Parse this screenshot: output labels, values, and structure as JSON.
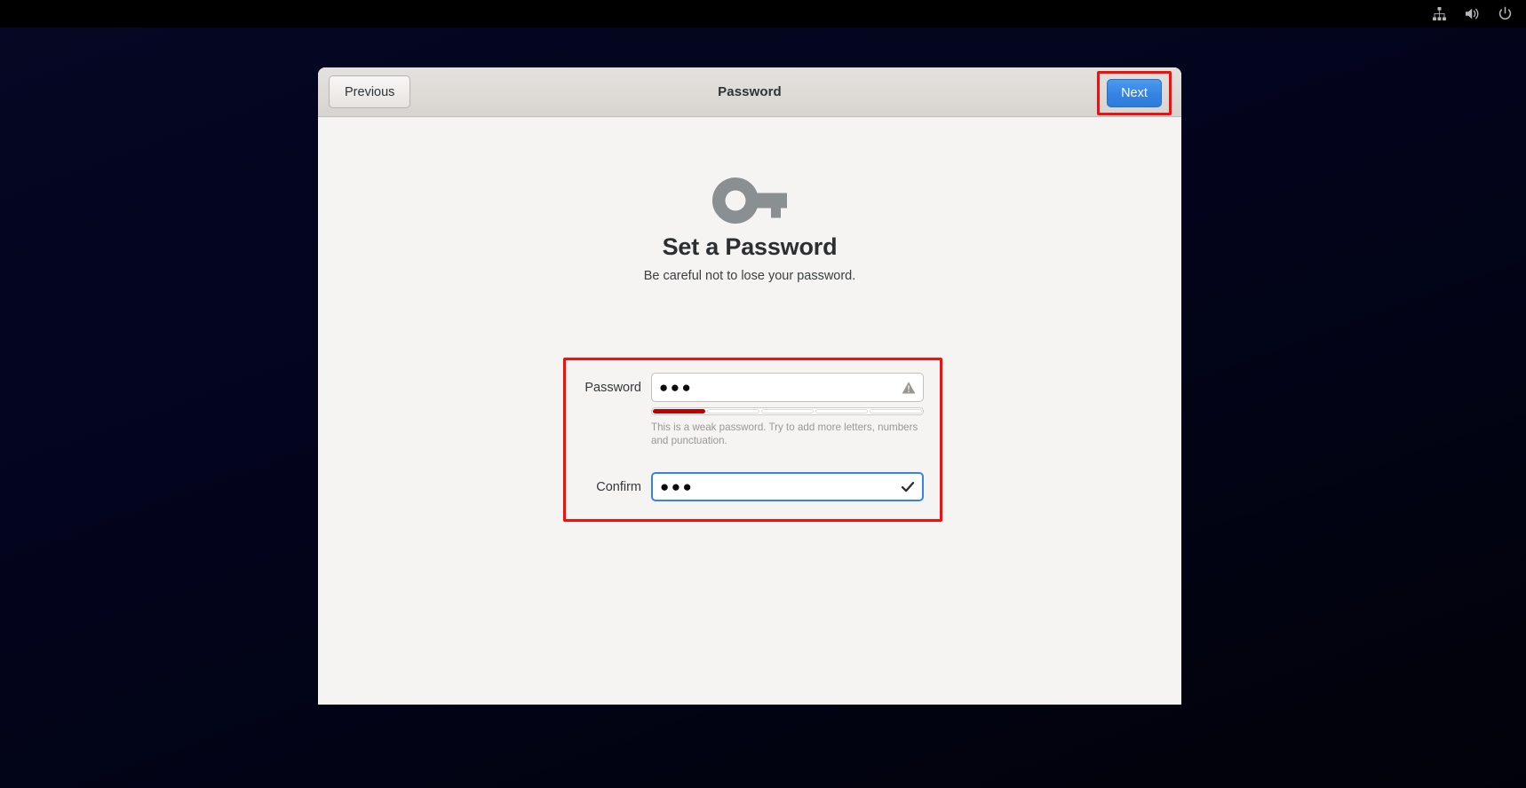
{
  "topbar": {
    "icons": [
      {
        "name": "network-icon",
        "label": "Network"
      },
      {
        "name": "volume-icon",
        "label": "Volume"
      },
      {
        "name": "power-icon",
        "label": "Power"
      }
    ]
  },
  "window": {
    "header": {
      "title": "Password",
      "previous_label": "Previous",
      "next_label": "Next",
      "next_highlight_color": "#fb0b0b"
    },
    "page": {
      "icon": "key-icon",
      "icon_color": "#8a8f92",
      "title": "Set a Password",
      "subtitle": "Be careful not to lose your password."
    },
    "form": {
      "highlight_color": "#fb0b0b",
      "password": {
        "label": "Password",
        "value": "●●●",
        "placeholder": "",
        "status_icon": "warning-triangle-icon",
        "focused": false
      },
      "strength": {
        "segments": 5,
        "filled": 1,
        "fill_color": "#c00000",
        "hint": "This is a weak password. Try to add more letters, numbers and punctuation."
      },
      "confirm": {
        "label": "Confirm",
        "value": "●●●",
        "placeholder": "",
        "status_icon": "checkmark-icon",
        "focused": true,
        "focus_color": "#3584e4"
      }
    }
  }
}
